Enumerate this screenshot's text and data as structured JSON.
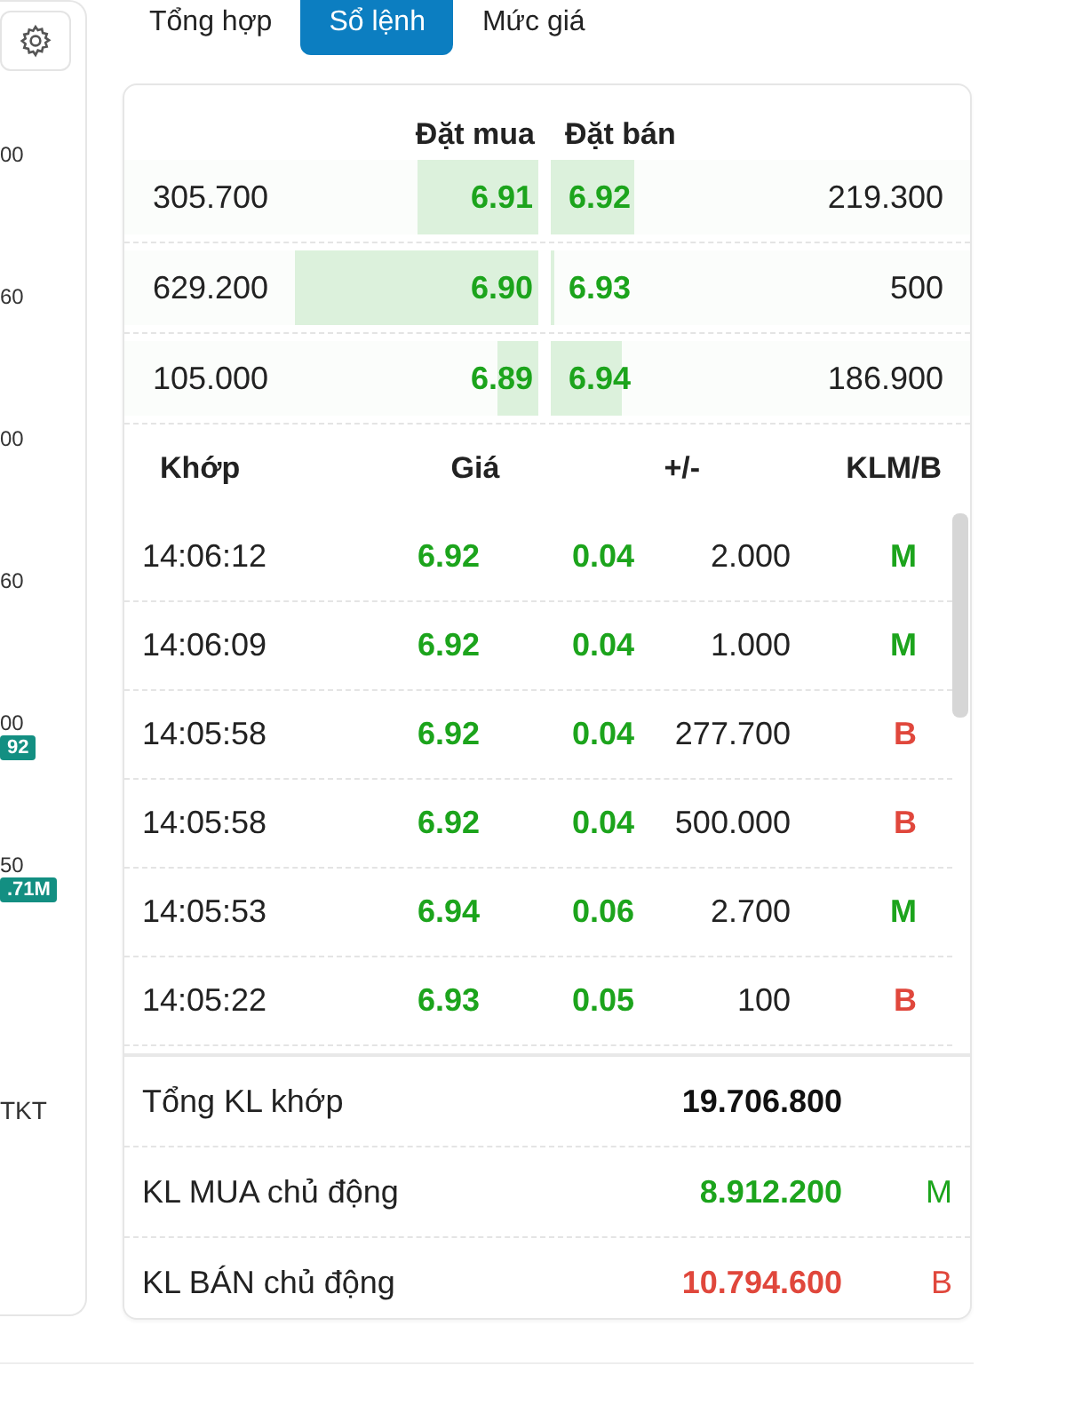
{
  "side_panel": {
    "axis_ticks": [
      {
        "label": "00"
      },
      {
        "label": "60"
      },
      {
        "label": "00"
      },
      {
        "label": "60"
      },
      {
        "label": "00",
        "badge": "92"
      },
      {
        "label": "50",
        "badge": ".71M"
      }
    ],
    "footer": "TKT"
  },
  "tabs": [
    {
      "label": "Tổng hợp",
      "selected": false
    },
    {
      "label": "Sổ lệnh",
      "selected": true
    },
    {
      "label": "Mức giá",
      "selected": false
    }
  ],
  "order_book": {
    "columns": [
      "Đặt mua",
      "Đặt bán"
    ],
    "rows": [
      {
        "bid": {
          "volume": "305.700",
          "price": "6.91",
          "level": 0.29
        },
        "ask": {
          "price": "6.92",
          "level": 0.2,
          "volume": "219.300"
        }
      },
      {
        "bid": {
          "volume": "629.200",
          "price": "6.90",
          "level": 0.59
        },
        "ask": {
          "price": "6.93",
          "level": 0.01,
          "volume": "500"
        }
      },
      {
        "bid": {
          "volume": "105.000",
          "price": "6.89",
          "level": 0.1
        },
        "ask": {
          "price": "6.94",
          "level": 0.17,
          "volume": "186.900"
        }
      }
    ]
  },
  "trades": {
    "columns": [
      "Khớp",
      "Giá",
      "+/-",
      "KLM/B"
    ],
    "rows": [
      {
        "time": "14:06:12",
        "price": "6.92",
        "change": "0.04",
        "volume": "2.000",
        "side": "M",
        "kind": "buy"
      },
      {
        "time": "14:06:09",
        "price": "6.92",
        "change": "0.04",
        "volume": "1.000",
        "side": "M",
        "kind": "buy"
      },
      {
        "time": "14:05:58",
        "price": "6.92",
        "change": "0.04",
        "volume": "277.700",
        "side": "B",
        "kind": "sell"
      },
      {
        "time": "14:05:58",
        "price": "6.92",
        "change": "0.04",
        "volume": "500.000",
        "side": "B",
        "kind": "sell"
      },
      {
        "time": "14:05:53",
        "price": "6.94",
        "change": "0.06",
        "volume": "2.700",
        "side": "M",
        "kind": "buy"
      },
      {
        "time": "14:05:22",
        "price": "6.93",
        "change": "0.05",
        "volume": "100",
        "side": "B",
        "kind": "sell"
      }
    ]
  },
  "summary": [
    {
      "label": "Tổng KL khớp",
      "value": "19.706.800",
      "kind": "total"
    },
    {
      "label": "KL MUA chủ động",
      "value": "8.912.200",
      "side": "M",
      "kind": "buy"
    },
    {
      "label": "KL BÁN chủ động",
      "value": "10.794.600",
      "side": "B",
      "kind": "sell"
    }
  ]
}
